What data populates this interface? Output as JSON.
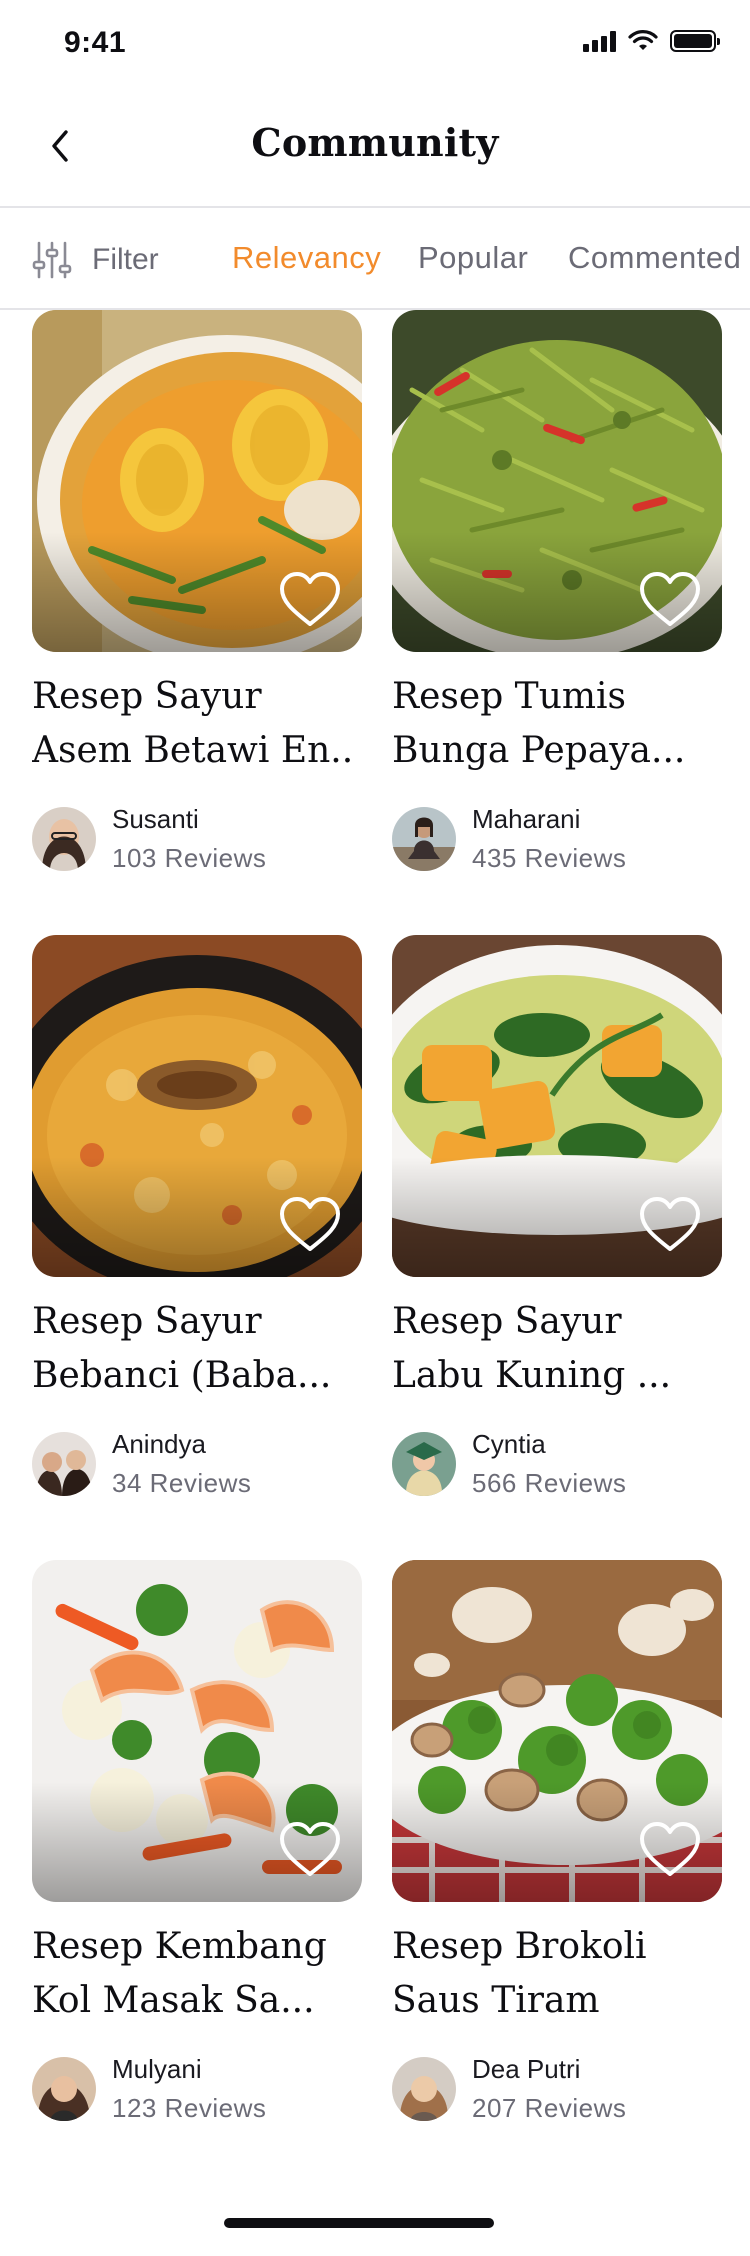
{
  "status_bar": {
    "time": "9:41"
  },
  "header": {
    "title": "Community"
  },
  "filter_bar": {
    "filter_label": "Filter",
    "tabs": [
      {
        "label": "Relevancy",
        "active": true
      },
      {
        "label": "Popular",
        "active": false
      },
      {
        "label": "Commented",
        "active": false
      }
    ]
  },
  "colors": {
    "accent": "#f28b2c",
    "text_primary": "#0e0e12",
    "text_secondary": "#6b6b76",
    "divider": "#e4e4e8"
  },
  "recipes": [
    {
      "title_line1": "Resep Sayur",
      "title_line2": "Asem Betawi En..",
      "author": "Susanti",
      "reviews": "103 Reviews"
    },
    {
      "title_line1": "Resep Tumis",
      "title_line2": "Bunga Pepaya...",
      "author": "Maharani",
      "reviews": "435 Reviews"
    },
    {
      "title_line1": "Resep Sayur",
      "title_line2": "Bebanci (Baba...",
      "author": "Anindya",
      "reviews": "34 Reviews"
    },
    {
      "title_line1": "Resep Sayur",
      "title_line2": "Labu Kuning ...",
      "author": "Cyntia",
      "reviews": "566 Reviews"
    },
    {
      "title_line1": "Resep Kembang",
      "title_line2": "Kol Masak Sa...",
      "author": "Mulyani",
      "reviews": "123 Reviews"
    },
    {
      "title_line1": "Resep Brokoli",
      "title_line2": "Saus Tiram",
      "author": "Dea Putri",
      "reviews": "207 Reviews"
    }
  ],
  "icons": {
    "back": "chevron-left-icon",
    "filter": "sliders-icon",
    "favorite": "heart-outline-icon"
  }
}
